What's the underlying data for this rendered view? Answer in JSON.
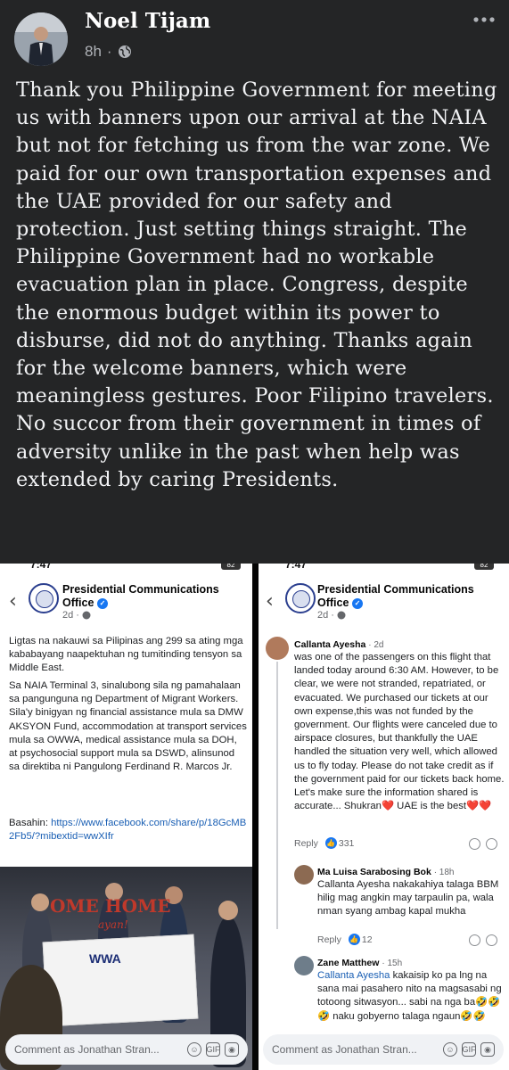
{
  "top_post": {
    "author": "Noel Tijam",
    "time": "8h",
    "visibility_icon": "globe-icon",
    "menu_icon": "more-icon",
    "body": "Thank you Philippine Government for meeting us with banners upon our arrival at the NAIA but not for fetching us from the war zone. We paid for our own transportation expenses and the UAE provided for our safety and protection. Just setting things straight. The Philippine Government had no workable evacuation plan in place. Congress, despite the enormous budget within its power to disburse, did not do anything. Thanks again for the welcome banners, which were meaningless gestures. Poor Filipino travelers. No succor from their government in times of adversity unlike in the past when help was extended by caring Presidents."
  },
  "left_panel": {
    "status_time": "7:47",
    "battery": "82",
    "page_name_line1": "Presidential Communications",
    "page_name_line2": "Office",
    "time": "2d",
    "paragraph1": "Ligtas na nakauwi sa Pilipinas ang 299 sa ating mga kababayang naapektuhan ng tumitinding tensyon sa Middle East.",
    "paragraph2": "Sa NAIA Terminal 3, sinalubong sila ng pamahalaan sa pangunguna ng Department of Migrant Workers. Sila'y binigyan ng financial assistance mula sa DMW AKSYON Fund, accommodation at transport services mula sa OWWA, medical assistance mula sa DOH, at psychosocial support mula sa DSWD, alinsunod sa direktiba ni Pangulong Ferdinand R. Marcos Jr.",
    "basahin_label": "Basahin:",
    "link": "https://www.facebook.com/share/p/18GcMB2Fb5/?mibextid=wwXIfr",
    "photo_banner_text": "OME HOME",
    "photo_banner_sub": "ayan!",
    "photo_banner_owwa": "WWA",
    "comment_placeholder": "Comment as Jonathan Stran..."
  },
  "right_panel": {
    "status_time": "7:47",
    "battery": "82",
    "page_name_line1": "Presidential Communications",
    "page_name_line2": "Office",
    "time": "2d",
    "comment1": {
      "name": "Callanta Ayesha",
      "time": "· 2d",
      "text": "was one of the passengers on this flight that landed today around 6:30 AM. However, to be clear, we were not stranded, repatriated, or evacuated. We purchased our tickets at our own expense,this was not funded by the government. Our flights were canceled due to airspace closures, but thankfully the UAE handled the situation very well, which allowed us to fly today. Please do not take credit as if the government paid for our tickets back home. Let's make sure the information shared is accurate... Shukran❤️ UAE is the best❤️❤️",
      "reply": "Reply",
      "reactions": "331"
    },
    "comment2": {
      "name": "Ma Luisa Sarabosing Bok",
      "time": "· 18h",
      "text": "Callanta Ayesha nakakahiya talaga BBM hilig mag angkin may tarpaulin pa, wala nman syang ambag kapal mukha",
      "reply": "Reply",
      "reactions": "12"
    },
    "comment3": {
      "name": "Zane Matthew",
      "time": "· 15h",
      "mention": "Callanta Ayesha",
      "text": " kakaisip ko pa lng na sana mai pasahero nito na magsasabi ng totoong sitwasyon... sabi na nga ba🤣🤣🤣 naku gobyerno talaga ngaun🤣🤣"
    },
    "comment_placeholder": "Comment as Jonathan Stran..."
  },
  "colors": {
    "dark_bg": "#242526",
    "fb_blue": "#1877f2",
    "link_blue": "#1a5fb4",
    "heart_red": "#f33e58"
  }
}
